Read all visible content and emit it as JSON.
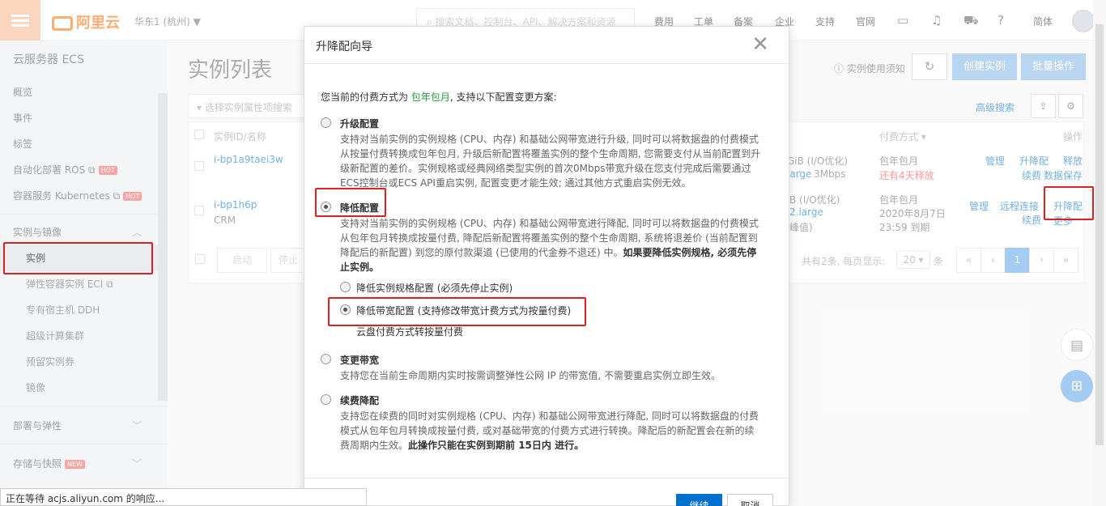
{
  "topbar": {
    "region": "华东1 (杭州)",
    "region_caret": "▼",
    "search_placeholder": "搜索文档、控制台、API、解决方案和资源",
    "nav": [
      "费用",
      "工单",
      "备案",
      "企业",
      "支持",
      "官网"
    ],
    "lang": "简体",
    "logo_text": "阿里云"
  },
  "sidebar": {
    "title": "云服务器 ECS",
    "items": [
      {
        "label": "概览"
      },
      {
        "label": "事件"
      },
      {
        "label": "标签"
      },
      {
        "label": "自动化部署 ROS",
        "badge": "HOT"
      },
      {
        "label": "容器服务 Kubernetes",
        "badge": "HOT"
      }
    ],
    "group1": {
      "label": "实例与镜像"
    },
    "sub_items": [
      {
        "label": "实例"
      },
      {
        "label": "弹性容器实例 ECI"
      },
      {
        "label": "专有宿主机 DDH"
      },
      {
        "label": "超级计算集群"
      },
      {
        "label": "预留实例券"
      },
      {
        "label": "镜像"
      }
    ],
    "group2": {
      "label": "部署与弹性"
    },
    "group3": {
      "label": "存储与快照",
      "badge": "NEW"
    }
  },
  "main": {
    "title": "实例列表",
    "notice": "实例使用须知",
    "create_btn": "创建实例",
    "batch_btn": "批量操作",
    "filter_placeholder": "选择实例属性项搜索",
    "advanced_search": "高级搜索",
    "headers": {
      "id": "实例ID/名称",
      "pay": "付费方式",
      "op": "操作"
    },
    "rows": [
      {
        "id": "i-bp1a9taei3w",
        "name": "",
        "spec_a": "GiB (I/O优化)",
        "spec_b": "large",
        "spec_c": "3Mbps",
        "pay1": "包年包月",
        "pay2": "还有4天释放",
        "ops": [
          "管理",
          "升降配",
          "释放",
          "续费",
          "数据保存"
        ]
      },
      {
        "id": "i-bp1h6p",
        "name": "CRM",
        "spec_a": "B (I/O优化)",
        "spec_b": "2.large",
        "spec_c": "峰值)",
        "pay1": "包年包月",
        "pay2": "2020年8月7日",
        "pay3": "23:59 到期",
        "ops": [
          "管理",
          "远程连接",
          "升降配",
          "续费",
          "更多"
        ]
      }
    ],
    "bottom_btns": [
      "启动",
      "停止"
    ],
    "pagination_text": "共有2条, 每页显示:",
    "page_size": "20",
    "page_unit": "条",
    "current_page": "1"
  },
  "modal": {
    "title": "升降配向导",
    "lead_prefix": "您当前的付费方式为",
    "lead_pay": "包年包月",
    "lead_suffix": ", 支持以下配置变更方案:",
    "options": [
      {
        "title": "升级配置",
        "desc": "支持对当前实例的实例规格 (CPU、内存) 和基础公网带宽进行升级, 同时可以将数据盘的付费模式从按量付费转换成包年包月, 升级后新配置将覆盖实例的整个生命周期, 您需要支付从当前配置到升级新配置的差价。实例规格或经典网络类型实例的首次0Mbps带宽升级在您支付完成后需要通过ECS控制台或ECS API重启实例, 配置变更才能生效; 通过其他方式重启实例无效。"
      },
      {
        "title": "降低配置",
        "desc": "支持对当前实例的实例规格 (CPU、内存) 和基础公网带宽进行降配, 同时可以将数据盘的付费模式从包年包月转换成按量付费, 降配后新配置将覆盖实例的整个生命周期, 系统将退差价 (当前配置到降配后的新配置) 到您的原付款渠道 (已使用的代金券不退还) 中。",
        "desc_bold": "如果要降低实例规格, 必须先停止实例。"
      },
      {
        "title": "变更带宽",
        "desc": "支持您在当前生命周期内实时按需调整弹性公网 IP 的带宽值, 不需要重启实例立即生效。"
      },
      {
        "title": "续费降配",
        "desc": "支持您在续费的同时对实例规格 (CPU、内存) 和基础公网带宽进行降配, 同时可以将数据盘的付费模式从包年包月转换成按量付费, 或对基础带宽的付费方式进行转换。降配后的新配置会在新的续费周期内生效。",
        "desc_bold": "此操作只能在实例到期前 15日内 进行。"
      }
    ],
    "sub_options": [
      "降低实例规格配置 (必须先停止实例)",
      "降低带宽配置 (支持修改带宽计费方式为按量付费)",
      "云盘付费方式转按量付费"
    ],
    "ok": "继续",
    "cancel": "取消"
  },
  "status_bar": "正在等待 acjs.aliyun.com 的响应..."
}
